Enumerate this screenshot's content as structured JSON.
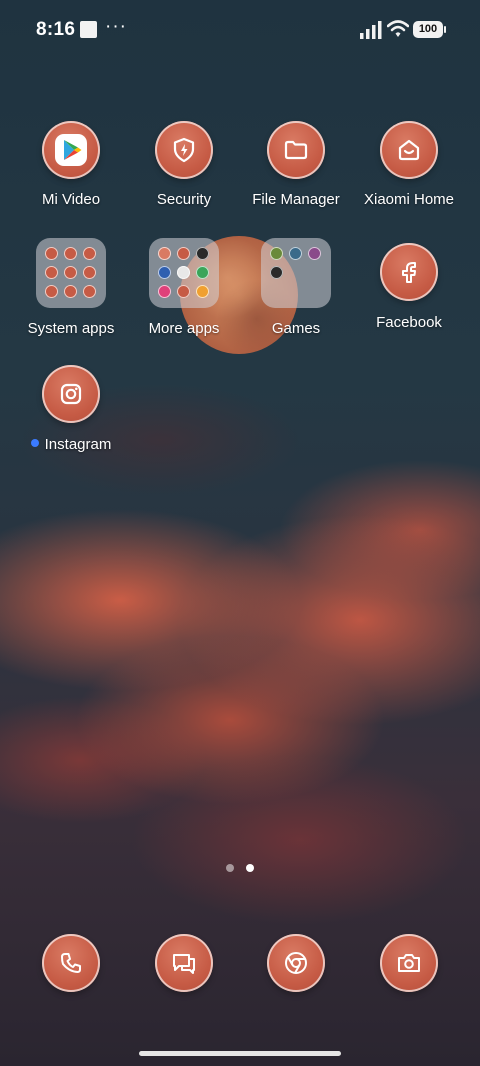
{
  "status_bar": {
    "time": "8:16",
    "more": "···",
    "battery": "100"
  },
  "apps": [
    {
      "label": "Mi Video",
      "icon": "play-store-icon"
    },
    {
      "label": "Security",
      "icon": "shield-lightning-icon"
    },
    {
      "label": "File Manager",
      "icon": "folder-icon"
    },
    {
      "label": "Xiaomi Home",
      "icon": "home-smile-icon"
    }
  ],
  "folders": [
    {
      "label": "System apps"
    },
    {
      "label": "More apps"
    },
    {
      "label": "Games"
    }
  ],
  "facebook": {
    "label": "Facebook",
    "icon": "facebook-f-icon"
  },
  "instagram": {
    "label": "Instagram",
    "icon": "instagram-icon"
  },
  "dock": [
    {
      "icon": "phone-icon"
    },
    {
      "icon": "messages-icon"
    },
    {
      "icon": "chrome-icon"
    },
    {
      "icon": "camera-icon"
    }
  ],
  "pages": {
    "count": 2,
    "current": 2
  },
  "colors": {
    "icon_fill": "#c65b45",
    "new_dot": "#3b7bff",
    "folder_bg": "rgba(210,210,215,0.55)"
  }
}
